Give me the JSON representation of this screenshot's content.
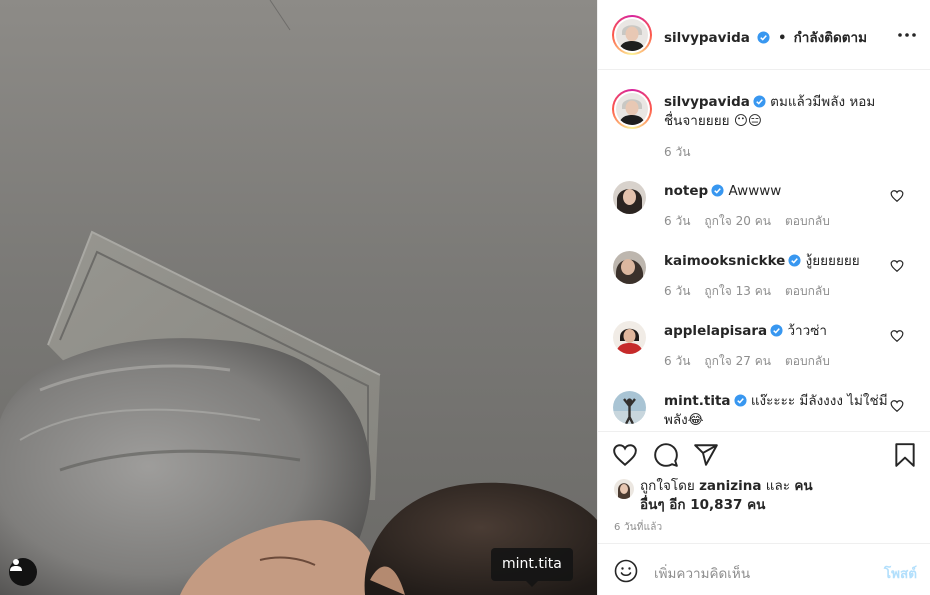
{
  "photo": {
    "tag_username": "mint.tita"
  },
  "header": {
    "username": "silvypavida",
    "separator": "•",
    "follow_status": "กำลังติดตาม"
  },
  "caption": {
    "username": "silvypavida",
    "text": "ตมแล้วมีพลัง หอมชื่นจายยยย 😶😑",
    "time": "6 วัน"
  },
  "comments": [
    {
      "username": "notep",
      "text": "Awwww",
      "time": "6 วัน",
      "likes": "ถูกใจ 20 คน",
      "reply": "ตอบกลับ"
    },
    {
      "username": "kaimooksnickke",
      "text": "งู้ยยยยยย",
      "time": "6 วัน",
      "likes": "ถูกใจ 13 คน",
      "reply": "ตอบกลับ"
    },
    {
      "username": "applelapisara",
      "text": "ว้าวซ่า",
      "time": "6 วัน",
      "likes": "ถูกใจ 27 คน",
      "reply": "ตอบกลับ"
    },
    {
      "username": "mint.tita",
      "text": "แง๊ะะะะ มีลังงงง ไม่ใช่มีพลัง😂"
    }
  ],
  "likes": {
    "prefix": "ถูกใจโดย",
    "user": "zanizina",
    "and": "และ",
    "others": "คนอื่นๆ อีก 10,837 คน"
  },
  "posted_ago": "6 วันที่แล้ว",
  "add_comment": {
    "placeholder": "เพิ่มความคิดเห็น",
    "post_label": "โพสต์"
  },
  "colors": {
    "verified": "#3897f0",
    "post_disabled": "#b2dffc",
    "muted": "#8e8e8e"
  }
}
